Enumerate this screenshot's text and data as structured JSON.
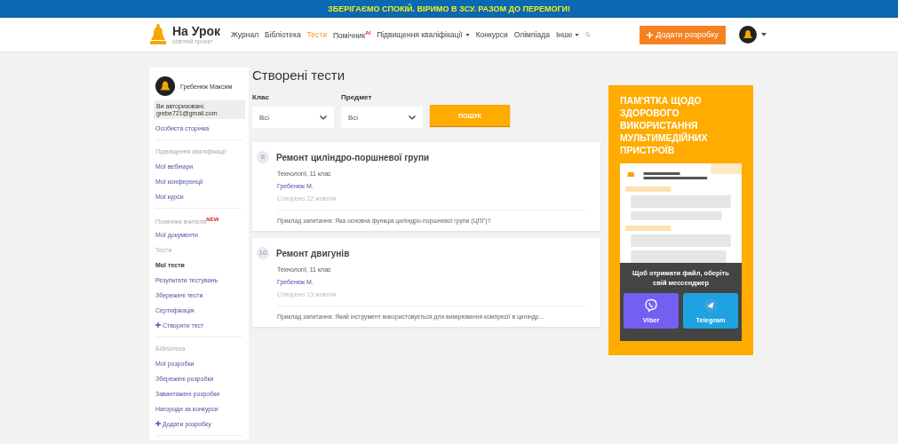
{
  "banner": "ЗБЕРІГАЄМО СПОКІЙ. ВІРИМО В ЗСУ. РАЗОМ ДО ПЕРЕМОГИ!",
  "logo": {
    "name": "На Урок",
    "subtitle": "освітній проект"
  },
  "nav": [
    {
      "label": "Журнал",
      "selected": false,
      "dropdown": false
    },
    {
      "label": "Бібліотека",
      "selected": false,
      "dropdown": false
    },
    {
      "label": "Тести",
      "selected": true,
      "dropdown": false
    },
    {
      "label": "Помічник",
      "badge": "AI",
      "selected": false,
      "dropdown": false
    },
    {
      "label": "Підвищення кваліфікації",
      "selected": false,
      "dropdown": true
    },
    {
      "label": "Конкурси",
      "selected": false,
      "dropdown": false
    },
    {
      "label": "Олімпіада",
      "selected": false,
      "dropdown": false
    },
    {
      "label": "Інше",
      "selected": false,
      "dropdown": true
    }
  ],
  "add_button": "Додати розробку",
  "sidebar": {
    "user": "Гребенюк Максим",
    "auth_label": "Ви авторизовані:",
    "email": "grebe721@gmail.com",
    "items": [
      {
        "kind": "link",
        "label": "Особиста сторінка"
      },
      {
        "kind": "divider"
      },
      {
        "kind": "heading",
        "label": "Підвищення кваліфікації"
      },
      {
        "kind": "link",
        "label": "Мої вебінари"
      },
      {
        "kind": "link",
        "label": "Мої конференції"
      },
      {
        "kind": "link",
        "label": "Мої курси"
      },
      {
        "kind": "divider"
      },
      {
        "kind": "heading",
        "label": "Помічник вчителя",
        "badge": "NEW"
      },
      {
        "kind": "link",
        "label": "Мої документи"
      },
      {
        "kind": "heading",
        "label": "Тести"
      },
      {
        "kind": "active",
        "label": "Мої тести"
      },
      {
        "kind": "link",
        "label": "Результати тестувань"
      },
      {
        "kind": "link",
        "label": "Збережені тести"
      },
      {
        "kind": "link",
        "label": "Сертифікація"
      },
      {
        "kind": "add",
        "label": "Створити тест"
      },
      {
        "kind": "divider"
      },
      {
        "kind": "heading",
        "label": "Бібліотека"
      },
      {
        "kind": "link",
        "label": "Мої розробки"
      },
      {
        "kind": "link",
        "label": "Збережені розробки"
      },
      {
        "kind": "link",
        "label": "Завантажені розробки"
      },
      {
        "kind": "link",
        "label": "Нагороди за конкурси"
      },
      {
        "kind": "add",
        "label": "Додати розробку"
      },
      {
        "kind": "divider"
      }
    ]
  },
  "page_title": "Створені тести",
  "filters": [
    {
      "label": "Клас",
      "value": "Всі"
    },
    {
      "label": "Предмет",
      "value": "Всі"
    }
  ],
  "search_button": "ПОШУК",
  "tests": [
    {
      "count": "8",
      "title": "Ремонт циліндро-поршневої групи",
      "subject": "Технології, 11 клас",
      "author": "Гребенюк М.",
      "created": "Створено 22 жовтня",
      "example": "Приклад запитання: Яка основна функція циліндро-поршневої групи (ЦПГ)?"
    },
    {
      "count": "10",
      "title": "Ремонт двигунів",
      "subject": "Технології, 11 клас",
      "author": "Гребенюк М.",
      "created": "Створено 13 жовтня",
      "example": "Приклад запитання: Який інструмент використовується для вимірювання компресії в циліндр..."
    }
  ],
  "promo": {
    "title": "ПАМ'ЯТКА ЩОДО ЗДОРОВОГО ВИКОРИСТАННЯ МУЛЬТИМЕДІЙНИХ ПРИСТРОЇВ",
    "prompt": "Щоб отримати файл, оберіть свій мессенджер",
    "buttons": [
      {
        "kind": "viber",
        "label": "Viber"
      },
      {
        "kind": "telegram",
        "label": "Telegram"
      }
    ]
  }
}
